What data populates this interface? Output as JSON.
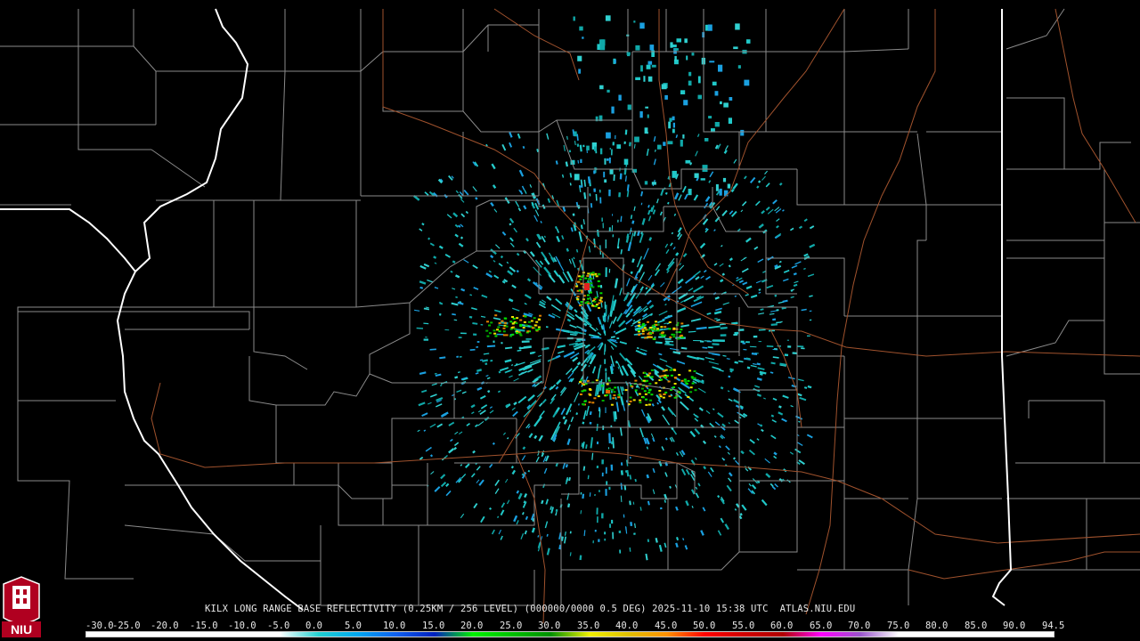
{
  "radar": {
    "caption": "KILX LONG RANGE BASE REFLECTIVITY (0.25KM / 256 LEVEL) (000000/0000 0.5 DEG) 2025-11-10 15:38 UTC  ATLAS.NIU.EDU",
    "site": "KILX",
    "product": "LONG RANGE BASE REFLECTIVITY",
    "tilt": "0.5 DEG",
    "timestamp": "2025-11-10 15:38 UTC",
    "source": "ATLAS.NIU.EDU"
  },
  "scale": {
    "labels": [
      "-30.0",
      "-25.0",
      "-20.0",
      "-15.0",
      "-10.0",
      "-5.0",
      "0.0",
      "5.0",
      "10.0",
      "15.0",
      "20.0",
      "25.0",
      "30.0",
      "35.0",
      "40.0",
      "45.0",
      "50.0",
      "55.0",
      "60.0",
      "65.0",
      "70.0",
      "75.0",
      "80.0",
      "85.0",
      "90.0",
      "94.5"
    ],
    "colors": [
      "#ffffff",
      "#ffffff",
      "#ffffff",
      "#ffffff",
      "#ffffff",
      "#ffffff",
      "#20d0d0",
      "#00a8f0",
      "#1060f0",
      "#0020c0",
      "#00f000",
      "#00c000",
      "#009000",
      "#f0f000",
      "#e0c000",
      "#ff9000",
      "#ff0000",
      "#d00000",
      "#b00000",
      "#ff00ff",
      "#9955cc",
      "#ffffff",
      "#ffffff",
      "#ffffff",
      "#ffffff"
    ]
  },
  "logo": {
    "text": "NIU",
    "name": "niu-logo"
  },
  "colors": {
    "background": "#000000",
    "county": "#8c8c8c",
    "state": "#ffffff",
    "road": "#a0522d"
  }
}
